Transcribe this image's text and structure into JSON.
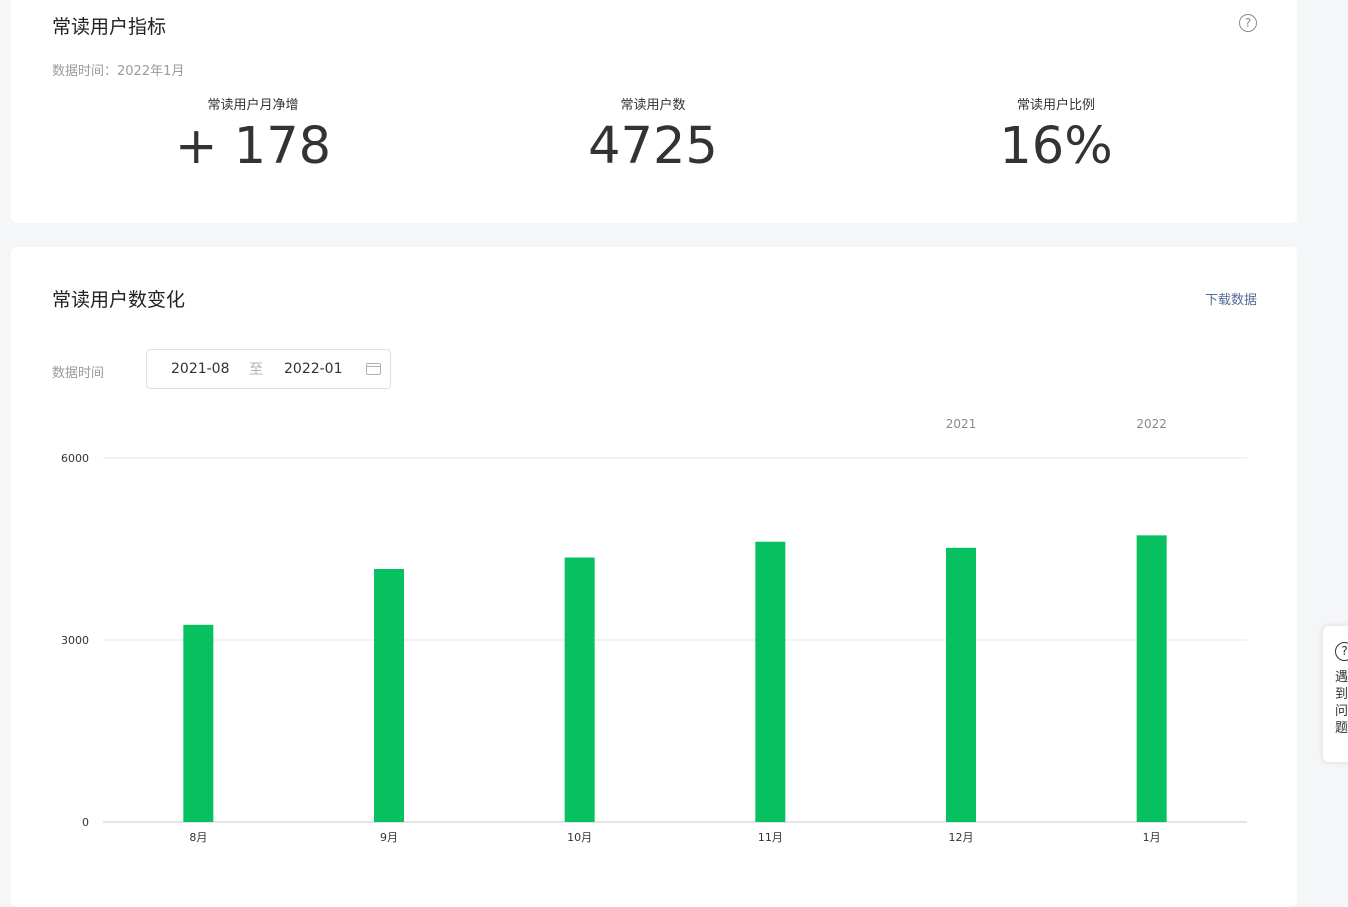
{
  "metrics_card": {
    "title": "常读用户指标",
    "help_glyph": "?",
    "data_time": "数据时间：2022年1月",
    "metrics": [
      {
        "label": "常读用户月净增",
        "value": "+ 178"
      },
      {
        "label": "常读用户数",
        "value": "4725"
      },
      {
        "label": "常读用户比例",
        "value": "16%"
      }
    ]
  },
  "trend_card": {
    "title": "常读用户数变化",
    "download_label": "下载数据",
    "filter_label": "数据时间",
    "date_start": "2021-08",
    "date_separator": "至",
    "date_end": "2022-01"
  },
  "chart_data": {
    "type": "bar",
    "categories": [
      "8月",
      "9月",
      "10月",
      "11月",
      "12月",
      "1月"
    ],
    "values": [
      3250,
      4170,
      4360,
      4620,
      4520,
      4725
    ],
    "year_labels": [
      {
        "text": "2021",
        "category_index": 4
      },
      {
        "text": "2022",
        "category_index": 5
      }
    ],
    "yticks": [
      0,
      3000,
      6000
    ],
    "ylim": [
      0,
      6000
    ],
    "bar_color": "#07c160",
    "grid": true
  },
  "floating_help": {
    "icon_glyph": "?",
    "text": "遇到问题"
  }
}
